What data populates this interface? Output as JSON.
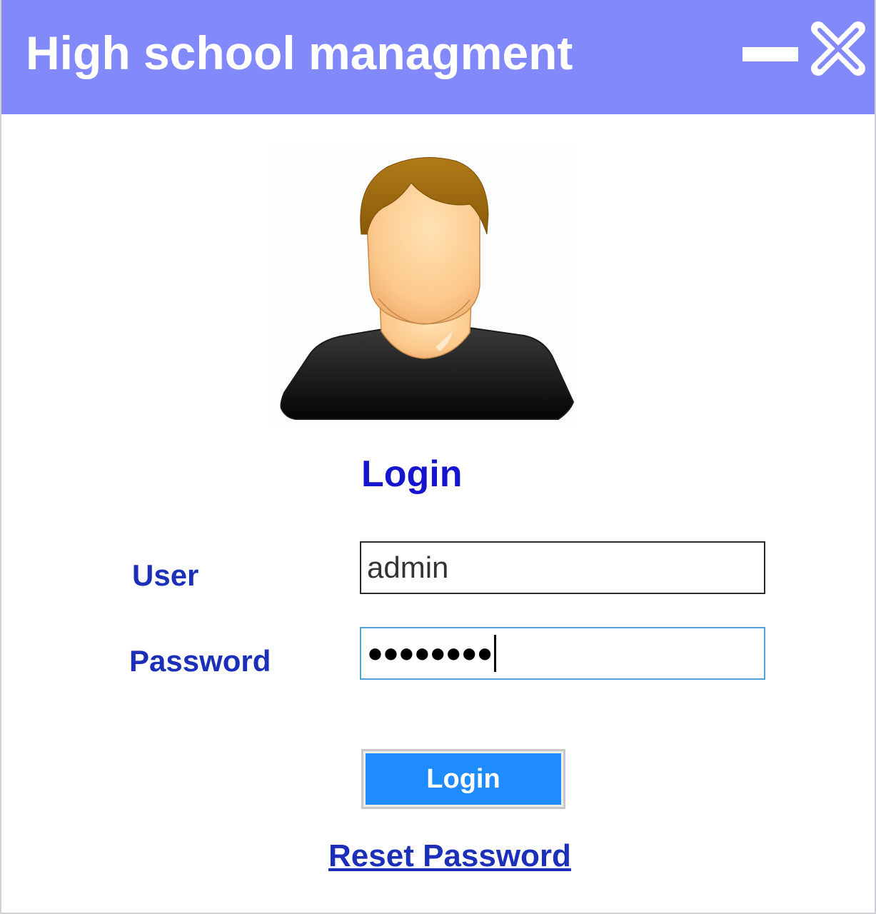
{
  "window": {
    "title": "High school managment",
    "minimize_icon": "minimize-icon",
    "close_icon": "close-icon"
  },
  "avatar": {
    "icon": "user-avatar-icon"
  },
  "form": {
    "heading": "Login",
    "user_label": "User",
    "user_value": "admin",
    "password_label": "Password",
    "password_mask": "●●●●●●●●",
    "login_button_label": "Login",
    "reset_link_label": "Reset Password"
  },
  "colors": {
    "titlebar": "#8289fb",
    "heading_text": "#1515d0",
    "label_text": "#1c2fb8",
    "button": "#1e8cff",
    "focused_input_border": "#4fa3d8"
  }
}
